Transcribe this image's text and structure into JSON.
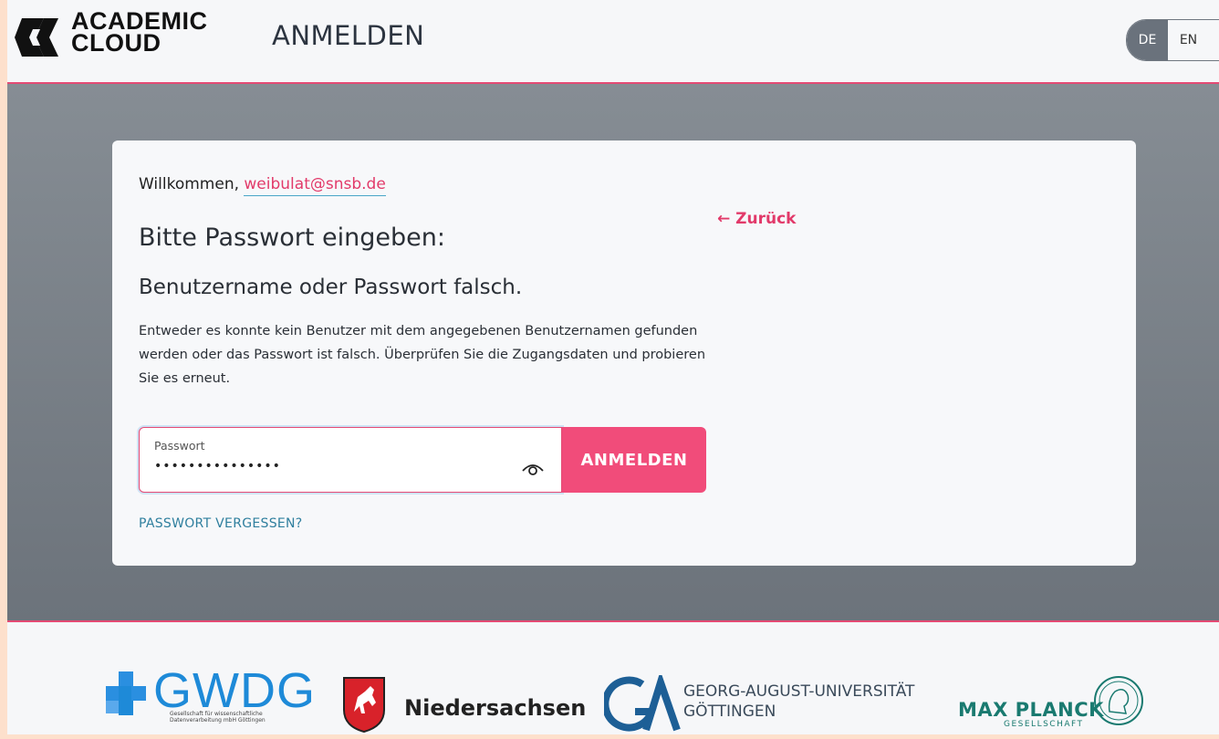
{
  "header": {
    "logo_line1": "ACADEMIC",
    "logo_line2": "CLOUD",
    "title": "ANMELDEN",
    "lang": {
      "active": "DE",
      "inactive": "EN"
    }
  },
  "card": {
    "welcome_prefix": "Willkommen, ",
    "email": "weibulat@snsb.de",
    "back_link": "← Zurück",
    "heading": "Bitte Passwort eingeben:",
    "error_title": "Benutzername oder Passwort falsch.",
    "error_text": "Entweder es konnte kein Benutzer mit dem angegebenen Benutzernamen gefunden werden oder das Passwort ist falsch. Überprüfen Sie die Zugangsdaten und probieren Sie es erneut.",
    "password_label": "Passwort",
    "password_value": "•••••••••••••••",
    "submit_label": "ANMELDEN",
    "forgot_link": "PASSWORT VERGESSEN?"
  },
  "footer": {
    "gwdg": {
      "name": "GWDG",
      "sub1": "Gesellschaft für wissenschaftliche",
      "sub2": "Datenverarbeitung mbH Göttingen"
    },
    "niedersachsen": {
      "name": "Niedersachsen"
    },
    "goettingen": {
      "line1": "GEORG-AUGUST-UNIVERSITÄT",
      "line2": "GÖTTINGEN"
    },
    "mpg": {
      "name": "MAX PLANCK",
      "sub": "GESELLSCHAFT"
    }
  },
  "colors": {
    "accent": "#e44a74",
    "button": "#f14c7a",
    "link_teal": "#2f7f9e",
    "header_bg": "#f6f7f9"
  }
}
